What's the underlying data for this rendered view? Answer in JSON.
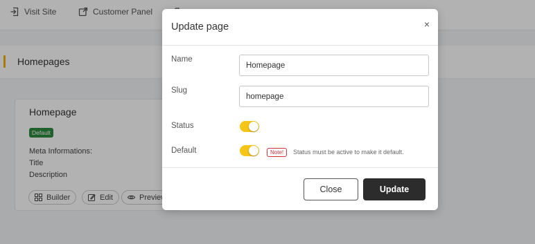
{
  "topbar": {
    "visit_site": "Visit Site",
    "customer_panel": "Customer Panel"
  },
  "page": {
    "title": "Homepages"
  },
  "card": {
    "title": "Homepage",
    "badge": "Default",
    "meta_heading": "Meta Informations:",
    "meta_title": "Title",
    "meta_description": "Description",
    "buttons": {
      "builder": "Builder",
      "edit": "Edit",
      "preview": "Preview"
    }
  },
  "modal": {
    "title": "Update page",
    "close_glyph": "×",
    "name_label": "Name",
    "name_value": "Homepage",
    "slug_label": "Slug",
    "slug_value": "homepage",
    "status_label": "Status",
    "status_on": true,
    "default_label": "Default",
    "default_on": true,
    "note_badge": "Note!",
    "note_text": "Status must be active to make it default.",
    "close_button": "Close",
    "update_button": "Update"
  },
  "colors": {
    "accent": "#f0b400",
    "toggle_on": "#f5c518",
    "badge_green": "#2e8b3e",
    "note_red": "#d0343a",
    "primary_button": "#2c2c2c"
  }
}
